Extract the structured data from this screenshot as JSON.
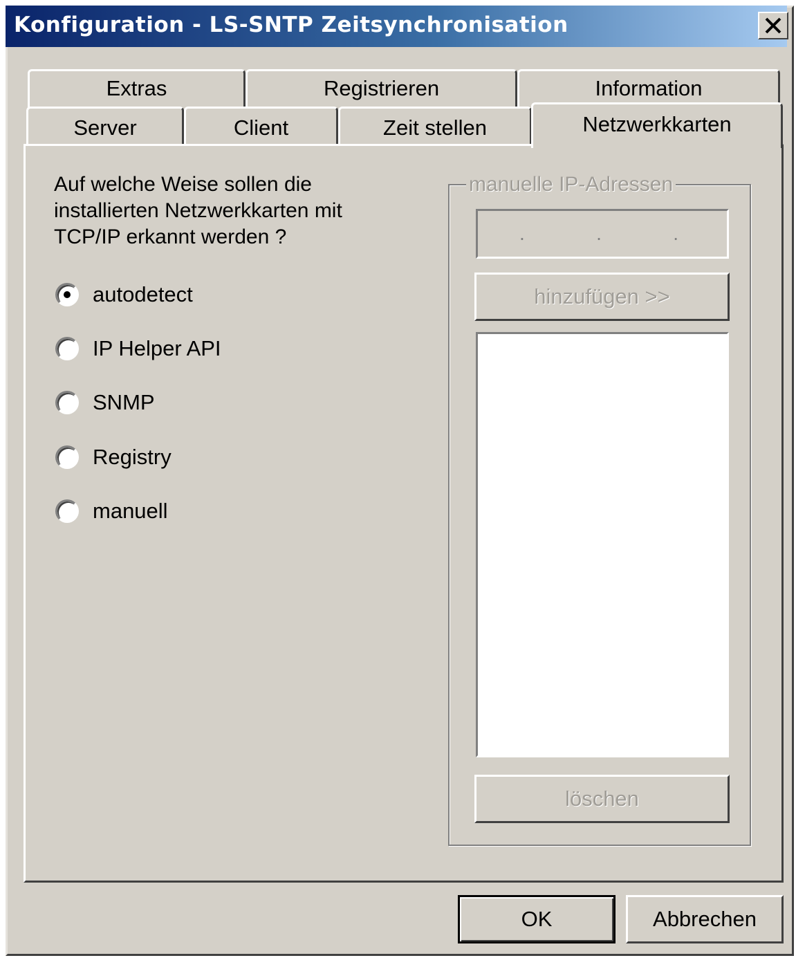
{
  "window": {
    "title": "Konfiguration - LS-SNTP Zeitsynchronisation",
    "close_label": "X"
  },
  "tabs": {
    "row_back": [
      {
        "label": "Extras"
      },
      {
        "label": "Registrieren"
      },
      {
        "label": "Information"
      }
    ],
    "row_front": [
      {
        "label": "Server"
      },
      {
        "label": "Client"
      },
      {
        "label": "Zeit stellen"
      },
      {
        "label": "Netzwerkkarten",
        "selected": true
      }
    ]
  },
  "panel": {
    "question": "Auf welche Weise sollen die installierten Netzwerkkarten mit TCP/IP erkannt werden ?",
    "options": [
      {
        "label": "autodetect",
        "selected": true
      },
      {
        "label": "IP Helper API",
        "selected": false
      },
      {
        "label": "SNMP",
        "selected": false
      },
      {
        "label": "Registry",
        "selected": false
      },
      {
        "label": "manuell",
        "selected": false
      }
    ],
    "manual_group": {
      "legend": "manuelle IP-Adressen",
      "ip_field_value": ".   .   .",
      "add_button": "hinzufügen >>",
      "delete_button": "löschen",
      "list_items": []
    }
  },
  "footer": {
    "ok_label": "OK",
    "cancel_label": "Abbrechen"
  }
}
